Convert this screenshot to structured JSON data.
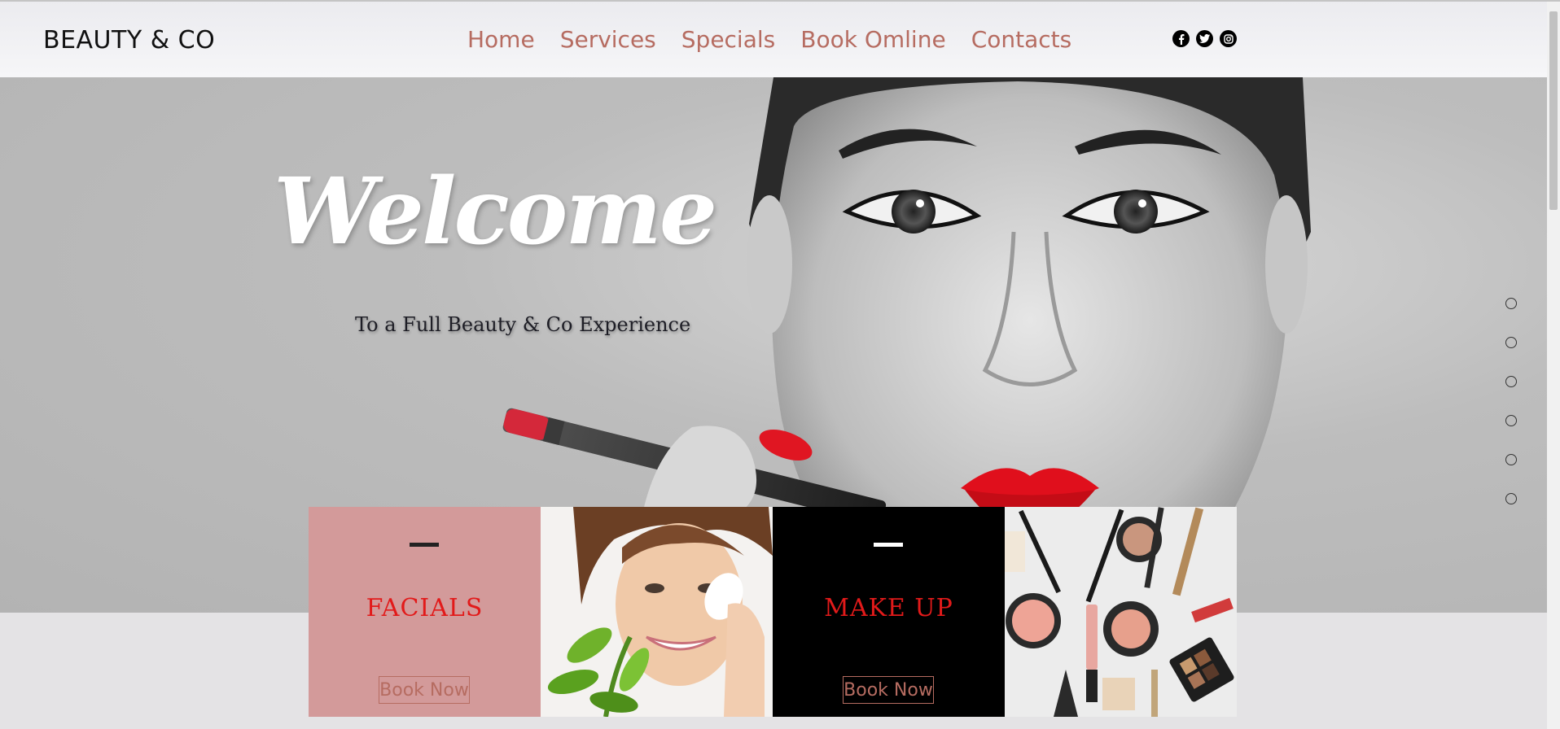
{
  "header": {
    "logo": "BEAUTY & CO",
    "nav": [
      "Home",
      "Services",
      "Specials",
      "Book Omline",
      "Contacts"
    ],
    "social": [
      "facebook-icon",
      "twitter-icon",
      "instagram-icon"
    ]
  },
  "hero": {
    "title": "Welcome",
    "tagline": "To a Full Beauty & Co Experience",
    "slide_count": 6
  },
  "cards": [
    {
      "type": "service",
      "title": "FACIALS",
      "button": "Book Now",
      "bg": "#d39a9a"
    },
    {
      "type": "image",
      "image": "smiling woman applying face cream with green leaves"
    },
    {
      "type": "service",
      "title": "MAKE UP",
      "button": "Book Now",
      "bg": "#000000"
    },
    {
      "type": "image",
      "image": "assorted makeup products and brushes"
    }
  ],
  "colors": {
    "accent": "#b66c61",
    "title_red": "#e21a1a",
    "pink": "#d39a9a"
  }
}
